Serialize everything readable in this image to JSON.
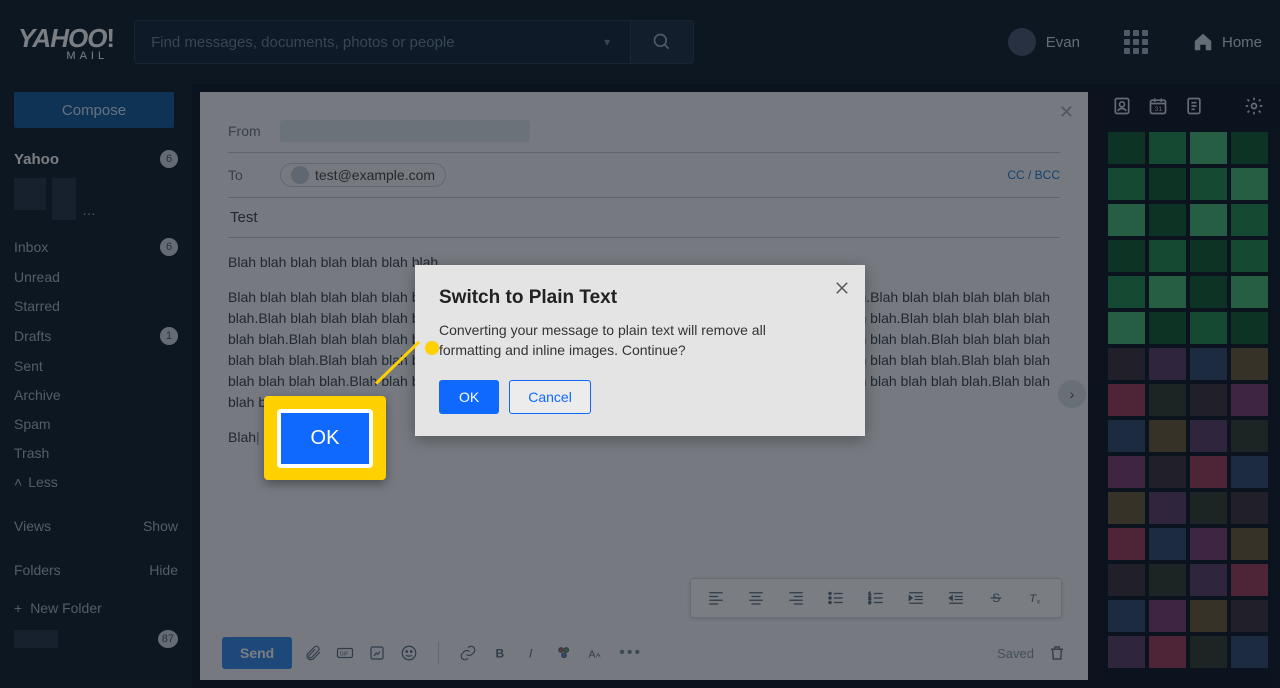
{
  "header": {
    "brand_main": "YAHOO",
    "brand_sub": "MAIL",
    "search_placeholder": "Find messages, documents, photos or people",
    "user_name": "Evan",
    "home_label": "Home"
  },
  "sidebar": {
    "compose_label": "Compose",
    "account_name": "Yahoo",
    "account_badge": "6",
    "items": [
      {
        "label": "Inbox",
        "badge": "6"
      },
      {
        "label": "Unread",
        "badge": ""
      },
      {
        "label": "Starred",
        "badge": ""
      },
      {
        "label": "Drafts",
        "badge": "1"
      },
      {
        "label": "Sent",
        "badge": ""
      },
      {
        "label": "Archive",
        "badge": ""
      },
      {
        "label": "Spam",
        "badge": ""
      },
      {
        "label": "Trash",
        "badge": ""
      }
    ],
    "less_label": "Less",
    "views_label": "Views",
    "views_action": "Show",
    "folders_label": "Folders",
    "folders_action": "Hide",
    "new_folder": "New Folder",
    "indexed_badge": "87"
  },
  "compose": {
    "from_label": "From",
    "to_label": "To",
    "to_value": "test@example.com",
    "ccbcc": "CC / BCC",
    "subject": "Test",
    "body_line_1": "Blah blah blah blah blah blah blah.",
    "body_para": "Blah blah blah blah blah blah blah.Blah blah blah blah blah blah blah.Blah blah blah blah blah blah blah.Blah blah blah blah blah blah blah.Blah blah blah blah blah blah blah.Blah blah blah blah blah blah blah.Blah blah blah blah blah blah blah.Blah blah blah blah blah blah blah.Blah blah blah blah blah blah blah.Blah blah blah blah blah blah blah.Blah blah blah blah blah blah blah.Blah blah blah blah blah blah blah.Blah blah blah blah blah blah blah.Blah blah blah blah blah blah blah.Blah blah blah blah blah blah blah.Blah blah blah blah blah blah blah.Blah blah blah blah blah blah blah.Blah blah blah blah blah blah blah.Blah blah blah blah blah blah blah.Blah blah blah blah blah blah blah.",
    "body_last": "Blah",
    "send_label": "Send",
    "saved_label": "Saved"
  },
  "modal": {
    "title": "Switch to Plain Text",
    "message": "Converting your message to plain text will remove all formatting and inline images. Continue?",
    "ok": "OK",
    "cancel": "Cancel"
  },
  "callout": {
    "label": "OK"
  }
}
